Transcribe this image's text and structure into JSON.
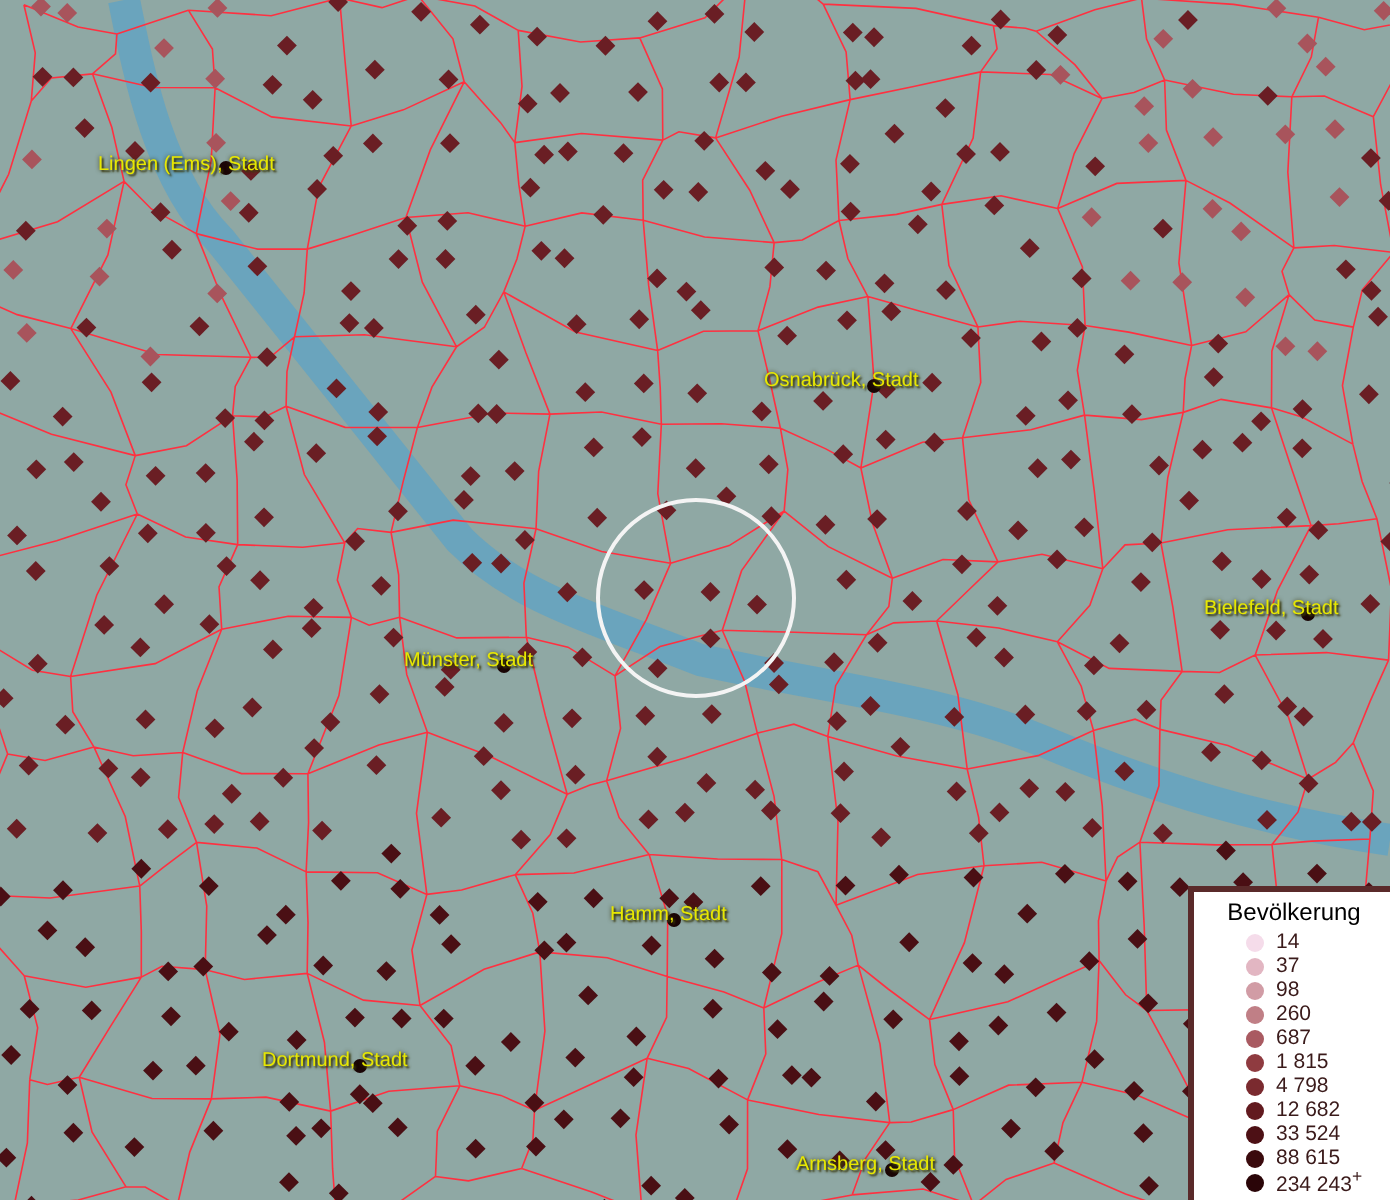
{
  "cities": [
    {
      "name": "Lingen (Ems), Stadt"
    },
    {
      "name": "Osnabrück, Stadt"
    },
    {
      "name": "Bielefeld, Stadt"
    },
    {
      "name": "Münster, Stadt"
    },
    {
      "name": "Hamm, Stadt"
    },
    {
      "name": "Dortmund, Stadt"
    },
    {
      "name": "Arnsberg, Stadt"
    }
  ],
  "legend": {
    "title": "Bevölkerung",
    "entries": [
      {
        "label": "14",
        "color": "#f5dcea"
      },
      {
        "label": "37",
        "color": "#e2b6c2"
      },
      {
        "label": "98",
        "color": "#d19ca5"
      },
      {
        "label": "260",
        "color": "#c07f86"
      },
      {
        "label": "687",
        "color": "#a95a61"
      },
      {
        "label": "1 815",
        "color": "#8f3b40"
      },
      {
        "label": "4 798",
        "color": "#7a2a2f"
      },
      {
        "label": "12 682",
        "color": "#621a1f"
      },
      {
        "label": "33 524",
        "color": "#4d1015"
      },
      {
        "label": "88 615",
        "color": "#3a0a0d"
      },
      {
        "label": "234 243$^{+}$",
        "color": "#2a0508"
      }
    ]
  }
}
